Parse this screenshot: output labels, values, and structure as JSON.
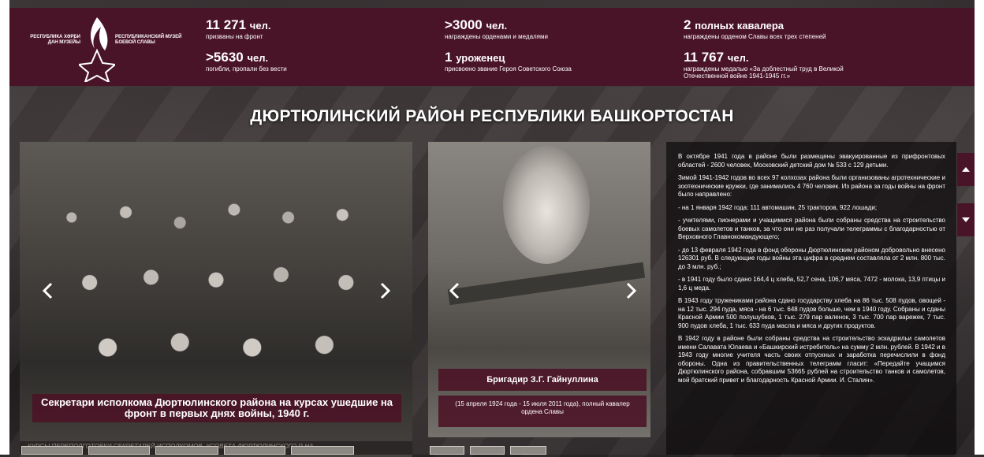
{
  "logo": {
    "left_text": "РЕСПУБЛИКА ХӘРБИ ДАН МУЗЕЙЫ",
    "right_text": "РЕСПУБЛИКАНСКИЙ МУЗЕЙ БОЕВОЙ СЛАВЫ"
  },
  "stats": [
    {
      "num": "11 271",
      "unit": "чел.",
      "desc": "призваны на фронт"
    },
    {
      "num": ">5630",
      "unit": "чел.",
      "desc": "погибли, пропали без вести"
    },
    {
      "num": ">3000",
      "unit": "чел.",
      "desc": "награждены орденами и медалями"
    },
    {
      "num": "1",
      "unit": "уроженец",
      "desc": "присвоено звание Героя Советского Союза"
    },
    {
      "num": "2",
      "unit": "полных кавалера",
      "desc": "награждены орденом Славы всех трех степеней"
    },
    {
      "num": "11 767",
      "unit": "чел.",
      "desc": "награждены медалью «За доблестный труд в Великой Отечественной войне 1941-1945 гг.»"
    }
  ],
  "title": "ДЮРТЮЛИНСКИЙ РАЙОН РЕСПУБЛИКИ БАШКОРТОСТАН",
  "slider1": {
    "caption": "Секретари исполкома Дюртюлинского района на курсах ушедшие на фронт в первых днях войны, 1940 г.",
    "photo_inscription": "КУРСЫ ПЕРЕПОДГОТОВКИ СЕКРЕТАРЕЙ ИСПОЛКОМОВ. УСОВЕТА ДЮРТЮЛИНСКОГО Р-НА"
  },
  "slider2": {
    "caption": "Бригадир З.Г. Гайнуллина",
    "subcaption": "(15 апреля 1924 года - 15 июля 2011 года), полный кавалер ордена Славы"
  },
  "text": [
    "В октябре 1941 года в районе были размещены эвакуированные из прифронтовых областей - 2600 человек, Московский детский дом № 533 с 129 детьми.",
    "Зимой 1941-1942 годов во всех 97 колхозах района были организованы агротехнические и зоотехнические кружки, где занимались 4 760 человек. Из района за годы войны на фронт было направлено:",
    "- на 1 января 1942 года: 111 автомашин, 25 тракторов, 922 лошади;",
    "- учителями, пионерами и учащимися района были собраны средства на строительство боевых самолетов и танков, за что они не раз получали телеграммы с благодарностью от Верховного Главнокомандующего;",
    "- до 13 февраля 1942 года в фонд обороны Дюртюлинским районом добровольно внесено 126301 руб. В следующие годы войны эта цифра в среднем составляла от 2 млн. 800 тыс. до 3 млн. руб.;",
    "- в 1941 году было сдано 164,4 ц хлеба, 52,7 сена, 106,7 мяса, 7472 - молока, 13,9 птицы и 1,6 ц меда.",
    "В 1943 году тружениками района сдано государству хлеба на 86 тыс. 508 пудов, овощей - на 12 тыс. 294 пуда, мяса - на 6 тыс. 648 пудов больше, чем в 1940 году. Собраны и сданы Красной Армии 500 полушубков, 1 тыс. 279 пар валенок, 3 тыс. 700 пар варежек, 7 тыс. 900 пудов хлеба, 1 тыс. 633 пуда масла и мяса и других продуктов.",
    "В 1942 году в районе были собраны средства на строительство эскадрильи самолетов имени Салавата Юлаева и «Башкирский истребитель» на сумму 2 млн. рублей. В 1942 и в 1943 году многие учителя часть своих отпускных и заработка перечислили в фонд обороны. Одна из правительственных телеграмм гласит: «Передайте учащимся Дюртюлинского района, собравшим 53665 рублей на строительство танков и самолетов, мой братский привет и благодарность Красной Армии. И. Сталин»."
  ],
  "colors": {
    "accent": "#4a1428",
    "panel": "#0f0c0e"
  }
}
